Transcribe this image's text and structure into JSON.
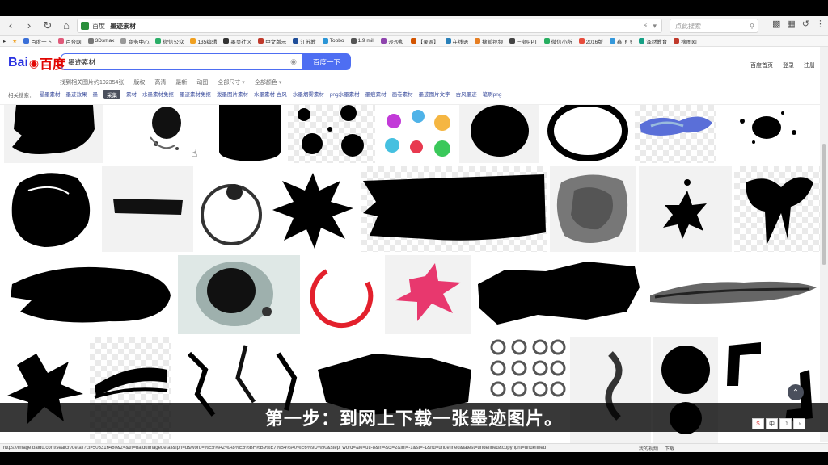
{
  "browser": {
    "tab_title": "墨迹素材",
    "site_label": "百度",
    "search_placeholder": "点此搜索"
  },
  "bookmarks": [
    {
      "label": "百度一下",
      "color": "#3a6fd8"
    },
    {
      "label": "百合网",
      "color": "#e05a7a"
    },
    {
      "label": "3Dsmax",
      "color": "#777777"
    },
    {
      "label": "商务中心",
      "color": "#999999"
    },
    {
      "label": "微信公众",
      "color": "#2aae67"
    },
    {
      "label": "135编辑",
      "color": "#f0a020"
    },
    {
      "label": "墨页社区",
      "color": "#333333"
    },
    {
      "label": "中文版示",
      "color": "#c0392b"
    },
    {
      "label": "江苏教",
      "color": "#1f4e99"
    },
    {
      "label": "Topbo",
      "color": "#2b95d6"
    },
    {
      "label": "1.9 mill",
      "color": "#555555"
    },
    {
      "label": "沙沙和",
      "color": "#8e44ad"
    },
    {
      "label": "【录源】",
      "color": "#d35400"
    },
    {
      "label": "在线语",
      "color": "#2980b9"
    },
    {
      "label": "搜狐视频",
      "color": "#e67e22"
    },
    {
      "label": "三顿PPT",
      "color": "#444444"
    },
    {
      "label": "微信小所",
      "color": "#27ae60"
    },
    {
      "label": "2016版",
      "color": "#e74c3c"
    },
    {
      "label": "鑫飞飞",
      "color": "#3498db"
    },
    {
      "label": "泽材教育",
      "color": "#16a085"
    },
    {
      "label": "搜图网",
      "color": "#c0392b"
    }
  ],
  "baidu": {
    "logo_bai": "Bai",
    "logo_du": "du",
    "logo_cn": "百度",
    "query": "墨迹素材",
    "search_button": "百度一下",
    "header_links": [
      "百度首页",
      "登录",
      "注册"
    ],
    "result_count": "找到相关图片约102354张",
    "filters": [
      {
        "label": "版权",
        "dropdown": false
      },
      {
        "label": "高清",
        "dropdown": false
      },
      {
        "label": "最新",
        "dropdown": false
      },
      {
        "label": "动图",
        "dropdown": false
      },
      {
        "label": "全部尺寸",
        "dropdown": true
      },
      {
        "label": "全部颜色",
        "dropdown": true
      }
    ],
    "related_label": "相关搜索：",
    "collect_button": "采集",
    "related": [
      "晕墨素材",
      "墨迹效果",
      "墨",
      "素材",
      "水墨素材免抠",
      "墨迹素材免抠",
      "泼墨图片素材",
      "水墨素材 古风",
      "水墨烟雾素材",
      "png水墨素材",
      "墨痕素材",
      "画卷素材",
      "墨迹图片文字",
      "古风墨迹",
      "笔刷png"
    ]
  },
  "caption": "第一步：到网上下载一张墨迹图片。",
  "ime": [
    "S",
    "中",
    "☽",
    "♪"
  ],
  "status": {
    "url": "https://image.baidu.com/search/detail?ct=503316480&z=&tn=baiduimagedetail&ipn=d&word=%E5%A2%A8%E8%BF%B9%E7%B4%A0%E6%9D%90&step_word=&ie=utf-8&in=&cl=2&lm=-1&st=-1&hd=undefined&latest=undefined&copyright=undefined",
    "right_items": [
      "我的视频",
      "下载"
    ]
  }
}
